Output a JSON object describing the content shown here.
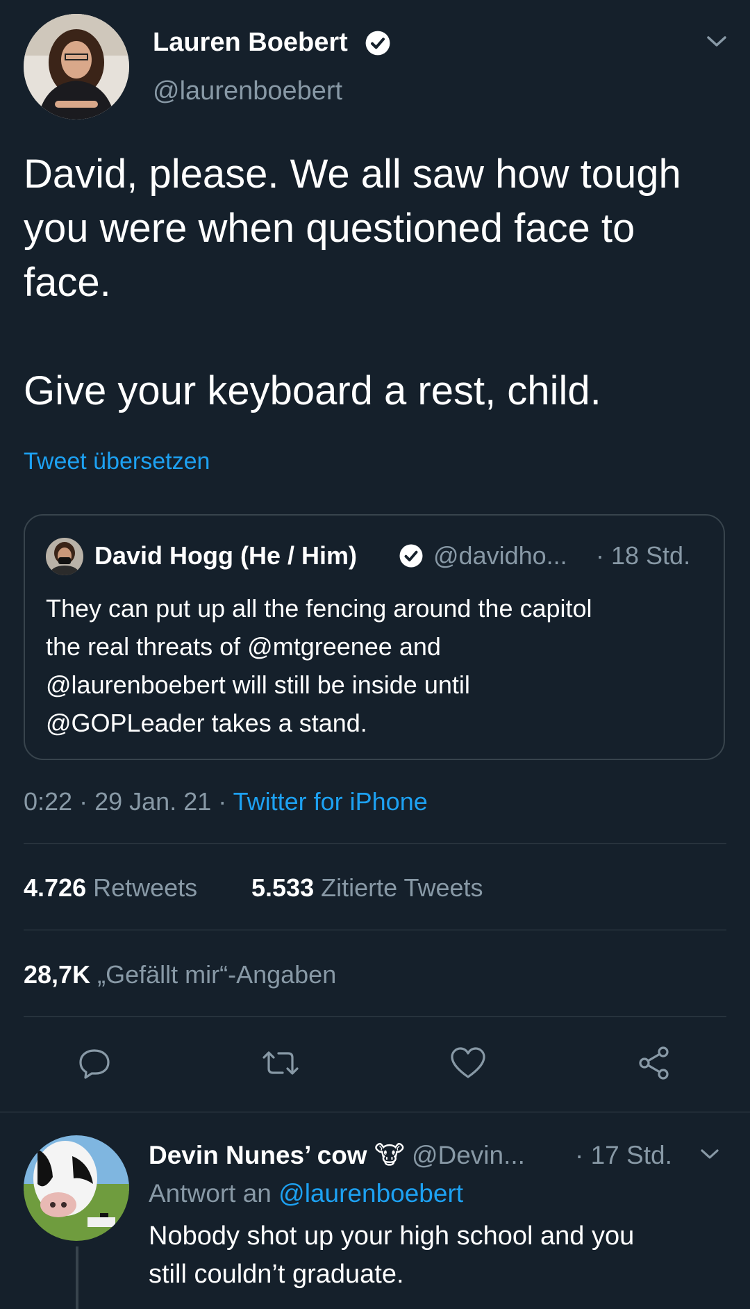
{
  "tweet": {
    "author_name": "Lauren Boebert",
    "author_handle": "@laurenboebert",
    "text_line1": "David, please. We all saw how tough",
    "text_line2": "you were when questioned face to",
    "text_line3": "face.",
    "text_line4": "Give your keyboard a rest, child.",
    "translate_label": "Tweet übersetzen",
    "time": "0:22",
    "sep1": "·",
    "date": "29 Jan. 21",
    "sep2": "·",
    "source": "Twitter for iPhone"
  },
  "quoted": {
    "author_name": "David Hogg (He / Him)",
    "author_handle": "@davidho...",
    "age": "· 18 Std.",
    "line1": "They can put up all the fencing around the capitol",
    "line2": "the real threats of @mtgreenee and",
    "line3": "@laurenboebert will still be inside until",
    "line4": "@GOPLeader takes a stand."
  },
  "stats": {
    "retweets_count": "4.726",
    "retweets_label": "Retweets",
    "quotes_count": "5.533",
    "quotes_label": "Zitierte Tweets",
    "likes_count": "28,7K",
    "likes_label": "„Gefällt mir“-Angaben"
  },
  "actions": {
    "reply_icon": "reply-icon",
    "retweet_icon": "retweet-icon",
    "like_icon": "heart-icon",
    "share_icon": "share-icon"
  },
  "reply": {
    "author_name": "Devin Nunes’ cow",
    "author_emoji": "🐮",
    "author_handle": "@Devin...",
    "age": "· 17 Std.",
    "replying_to_label": "Antwort an",
    "replying_to_handle": "@laurenboebert",
    "line1": "Nobody shot up your high school and you",
    "line2": "still couldn’t graduate."
  },
  "colors": {
    "background": "#15202b",
    "accent": "#1da1f2",
    "muted": "#8899a6",
    "divider": "#38444d"
  }
}
